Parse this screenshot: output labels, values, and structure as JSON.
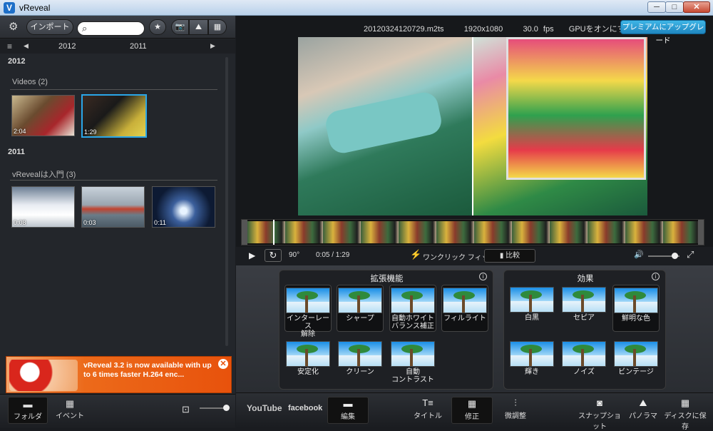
{
  "window": {
    "title": "vReveal",
    "logo_letter": "V",
    "min": "─",
    "max": "□",
    "close": "✕"
  },
  "toolbar": {
    "import_label": "インポート",
    "star": "★",
    "snapshot_icon": "📷",
    "panorama_icon": "⛰",
    "film_icon": "▦",
    "settings_icon": "⚙"
  },
  "search": {
    "placeholder": "",
    "icon": "⌕"
  },
  "datebar": {
    "years": [
      "2012",
      "2011"
    ],
    "prev": "◀",
    "next": "▶",
    "menu_icon": "≡"
  },
  "library": {
    "groups": [
      {
        "year": "2012",
        "section": "Videos (2)",
        "items": [
          {
            "duration": "2:04"
          },
          {
            "duration": "1:29"
          }
        ]
      },
      {
        "year": "2011",
        "section": "vRevealは入門 (3)",
        "items": [
          {
            "duration": "0:08"
          },
          {
            "duration": "0:03"
          },
          {
            "duration": "0:11"
          }
        ]
      }
    ]
  },
  "ad": {
    "text": "vReveal 3.2 is now available with up to 6 times faster H.264 enc...",
    "close": "✕"
  },
  "left_tabs": {
    "folder": "フォルダ",
    "event": "イベント"
  },
  "player": {
    "filename": "20120324120729.m2ts",
    "resolution": "1920x1080",
    "fps": "30.0 fps",
    "gpu_label": "GPUをオンにする",
    "premium_label": "プレミアムにアップグレード",
    "play": "▶",
    "rotate": "↻",
    "rotate_label": "90°",
    "time": "0:05 / 1:29",
    "oneclick_label": "ワンクリック フィックス",
    "compare_label": "比較",
    "volume_icon": "🔊",
    "fullscreen_icon": "⤢",
    "progress": 0.056,
    "volume": 0.85
  },
  "enhance": {
    "title": "拡張機能",
    "info": "i",
    "items": [
      "インターレース\n解除",
      "シャープ",
      "自動ホワイト\nバランス補正",
      "フィルライト",
      "安定化",
      "クリーン",
      "自動\nコントラスト"
    ]
  },
  "effects": {
    "title": "効果",
    "info": "i",
    "items": [
      "白黒",
      "セピア",
      "鮮明な色",
      "輝き",
      "ノイズ",
      "ビンテージ"
    ]
  },
  "bottom": {
    "youtube": "YouTube",
    "facebook": "facebook",
    "edit": "編集",
    "title_btn": "タイトル",
    "fix": "修正",
    "adjust": "微調整",
    "snapshot": "スナップショット",
    "panorama": "パノラマ",
    "disc": "ディスクに保存"
  },
  "colors": {
    "accent": "#1f86c0",
    "selected_border": "#2aa6e8",
    "ad_orange": "#e8520c"
  }
}
